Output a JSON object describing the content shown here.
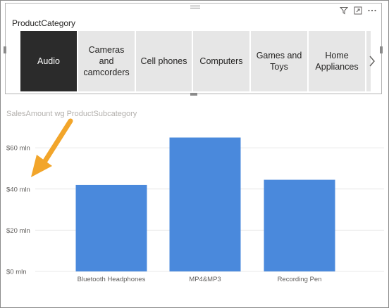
{
  "slicer": {
    "title": "ProductCategory",
    "tiles": [
      {
        "label": "Audio",
        "selected": true
      },
      {
        "label": "Cameras and camcorders",
        "selected": false
      },
      {
        "label": "Cell phones",
        "selected": false
      },
      {
        "label": "Computers",
        "selected": false
      },
      {
        "label": "Games and Toys",
        "selected": false
      },
      {
        "label": "Home Appliances",
        "selected": false
      }
    ],
    "header_icons": [
      "filter-icon",
      "focus-mode-icon",
      "more-options-icon"
    ]
  },
  "chart": {
    "title": "SalesAmount wg ProductSubcategory",
    "annotation": "orange arrow pointing to y-axis label $40 mln"
  },
  "colors": {
    "bar": "#4a89dc",
    "selected_tile": "#2b2b2b",
    "tile": "#e6e6e6",
    "arrow": "#f2a52a"
  },
  "chart_data": {
    "type": "bar",
    "title": "SalesAmount wg ProductSubcategory",
    "categories": [
      "Bluetooth Headphones",
      "MP4&MP3",
      "Recording Pen"
    ],
    "values": [
      42,
      65,
      44.5
    ],
    "yticks": [
      "$0 mln",
      "$20 mln",
      "$40 mln",
      "$60 mln"
    ],
    "ytick_values": [
      0,
      20,
      40,
      60
    ],
    "ylim": [
      0,
      70
    ],
    "grid": true,
    "xlabel": "",
    "ylabel": ""
  }
}
